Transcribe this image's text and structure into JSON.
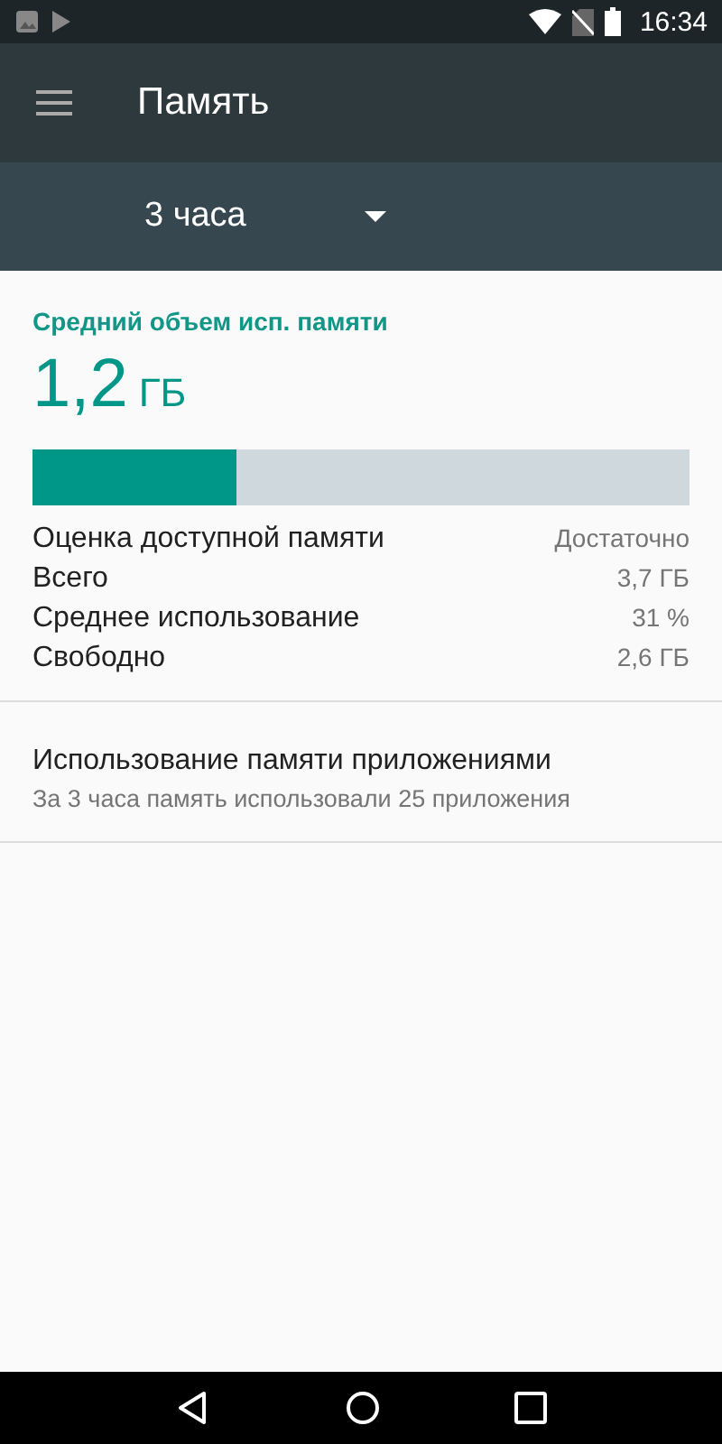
{
  "status_bar": {
    "time": "16:34"
  },
  "app_bar": {
    "title": "Память"
  },
  "spinner": {
    "value": "3 часа"
  },
  "summary": {
    "heading": "Средний объем исп. памяти",
    "amount": "1,2",
    "unit": "ГБ",
    "level": 0.31
  },
  "stats": [
    {
      "label": "Оценка доступной памяти",
      "value": "Достаточно"
    },
    {
      "label": "Всего",
      "value": "3,7 ГБ"
    },
    {
      "label": "Среднее использование",
      "value": "31 %"
    },
    {
      "label": "Свободно",
      "value": "2,6 ГБ"
    }
  ],
  "apps_item": {
    "title": "Использование памяти приложениями",
    "subtitle": "За 3 часа память использовали 25 приложения"
  }
}
